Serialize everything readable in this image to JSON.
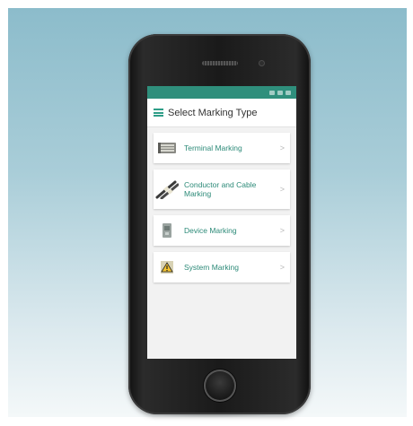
{
  "app": {
    "title": "Select Marking Type"
  },
  "items": [
    {
      "label": "Terminal Marking",
      "icon": "terminal-marker-icon",
      "chevron": ">"
    },
    {
      "label": "Conductor and Cable Marking",
      "icon": "cable-marker-icon",
      "chevron": ">"
    },
    {
      "label": "Device Marking",
      "icon": "device-marker-icon",
      "chevron": ">"
    },
    {
      "label": "System Marking",
      "icon": "system-warning-icon",
      "chevron": ">"
    }
  ],
  "colors": {
    "accent": "#2f9e88",
    "label": "#2c8a78",
    "statusbar": "#2f8f7c",
    "background": "#9fc7d3"
  }
}
